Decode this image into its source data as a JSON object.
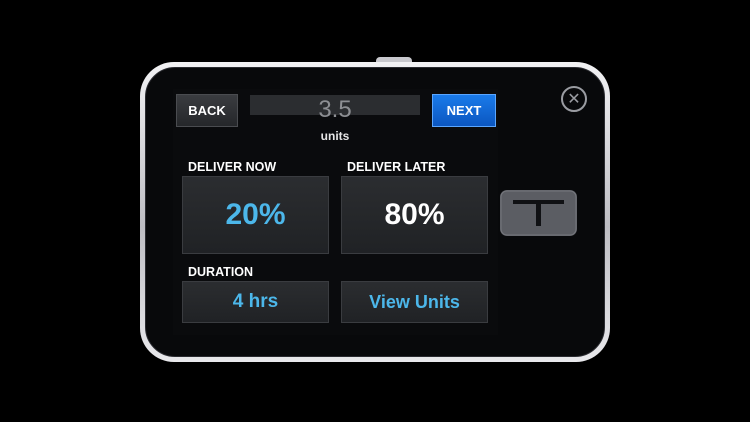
{
  "nav": {
    "back_label": "BACK",
    "next_label": "NEXT"
  },
  "amount": {
    "value": "3.5",
    "unit": "units"
  },
  "deliver_now": {
    "label": "DELIVER NOW",
    "value": "20%"
  },
  "deliver_later": {
    "label": "DELIVER LATER",
    "value": "80%"
  },
  "duration": {
    "label": "DURATION",
    "value": "4 hrs"
  },
  "view_units": {
    "label": "View Units"
  },
  "close": {
    "glyph": "✕"
  },
  "colors": {
    "accent_blue": "#4cb7ea",
    "next_button": "#1a7bea",
    "screen_bg": "#0a0b0d"
  },
  "icons": {
    "close": "close-icon",
    "brand": "t-logo-icon"
  }
}
